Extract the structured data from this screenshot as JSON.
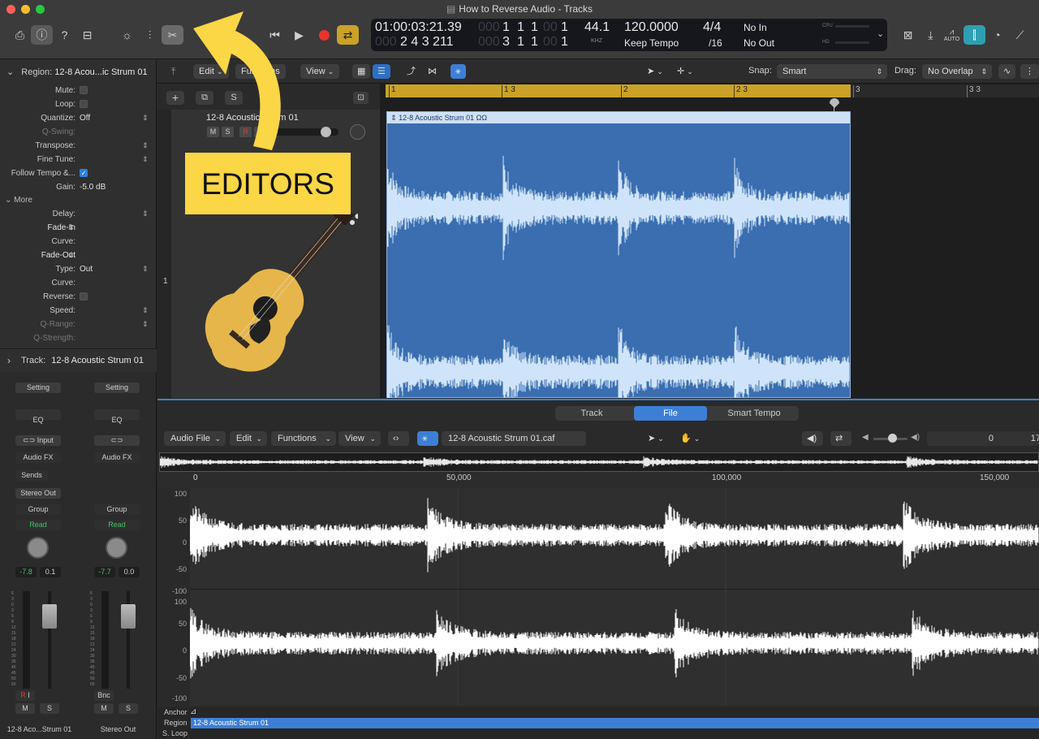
{
  "window": {
    "title": "How to Reverse Audio - Tracks"
  },
  "colors": {
    "accent": "#3d7fd6",
    "cycle": "#c9a227",
    "callout": "#fbd645",
    "record": "#e8332b",
    "region": "#3a6eb0"
  },
  "lcd": {
    "time": "01:00:03:21.39",
    "bars_top": [
      "1",
      "1",
      "1",
      "1"
    ],
    "bars_bottom_pre": "2 4 3 211",
    "bars_bottom": [
      "3",
      "1",
      "1",
      "1"
    ],
    "sample_rate": "44.1",
    "khz": "KHZ",
    "tempo": "120.0000",
    "tempo_mode": "Keep Tempo",
    "sig_top": "4/4",
    "sig_bottom": "/16",
    "in": "No In",
    "out": "No Out",
    "cpu": "CPU",
    "hd": "HD"
  },
  "toolbar": {
    "auto": "AUTO"
  },
  "inspector": {
    "region_label": "Region:",
    "region_name": "12-8 Acou...ic Strum 01",
    "rows": [
      {
        "label": "Mute:",
        "value": ""
      },
      {
        "label": "Loop:",
        "value": ""
      },
      {
        "label": "Quantize:",
        "value": "Off"
      },
      {
        "label": "Q-Swing:",
        "value": ""
      },
      {
        "label": "Transpose:",
        "value": ""
      },
      {
        "label": "Fine Tune:",
        "value": ""
      },
      {
        "label": "Follow Tempo &...",
        "value": ""
      },
      {
        "label": "Gain:",
        "value": "-5.0 dB"
      }
    ],
    "more": "More",
    "more_rows": [
      {
        "label": "Delay:",
        "value": ""
      },
      {
        "label": "Fade-In",
        "value": ""
      },
      {
        "label": "Curve:",
        "value": ""
      },
      {
        "label": "Fade-Out",
        "value": ""
      },
      {
        "label": "Type:",
        "value": "Out"
      },
      {
        "label": "Curve:",
        "value": ""
      },
      {
        "label": "Reverse:",
        "value": ""
      },
      {
        "label": "Speed:",
        "value": ""
      },
      {
        "label": "Q-Range:",
        "value": ""
      },
      {
        "label": "Q-Strength:",
        "value": ""
      }
    ],
    "track_label": "Track:",
    "track_name": "12-8 Acoustic Strum 01"
  },
  "mixer": {
    "strips": [
      {
        "setting": "Setting",
        "eq": "EQ",
        "input": "Input",
        "fx": "Audio FX",
        "sends": "Sends",
        "out": "Stereo Out",
        "group": "Group",
        "read": "Read",
        "vol": "-7.8",
        "pan": "0.1",
        "extra": "R  I",
        "name": "12-8 Aco...Strum 01",
        "m": "M",
        "s": "S"
      },
      {
        "setting": "Setting",
        "eq": "EQ",
        "input": "",
        "fx": "Audio FX",
        "sends": "",
        "out": "",
        "group": "Group",
        "read": "Read",
        "vol": "-7.7",
        "pan": "0.0",
        "extra": "Bnc",
        "name": "Stereo Out",
        "m": "M",
        "s": "S"
      }
    ]
  },
  "tracks_bar": {
    "edit": "Edit",
    "functions": "Functions",
    "view": "View",
    "snap_label": "Snap:",
    "snap_value": "Smart",
    "drag_label": "Drag:",
    "drag_value": "No Overlap"
  },
  "track_header": {
    "name": "12-8 Acoustic Strum 01",
    "m": "M",
    "s": "S",
    "r": "R",
    "i": "I",
    "number": "1",
    "add": "+",
    "solo": "S"
  },
  "ruler": {
    "marks": [
      "1",
      "1 3",
      "2",
      "2 3",
      "3",
      "3 3"
    ]
  },
  "region": {
    "name": "12-8 Acoustic Strum 01"
  },
  "callout": {
    "text": "EDITORS"
  },
  "editor": {
    "tabs": [
      "Track",
      "File",
      "Smart Tempo"
    ],
    "active_tab": "File",
    "audio_file": "Audio File",
    "edit": "Edit",
    "functions": "Functions",
    "view": "View",
    "file_name": "12-8 Acoustic Strum 01.caf",
    "position": "0",
    "position_right": "17",
    "ruler": [
      "0",
      "50,000",
      "100,000",
      "150,000"
    ],
    "yticks": [
      "100",
      "50",
      "0",
      "-50",
      "-100"
    ],
    "anchor": "Anchor",
    "region_label": "Region",
    "region_name": "12-8 Acoustic Strum 01",
    "sloop": "S. Loop"
  }
}
